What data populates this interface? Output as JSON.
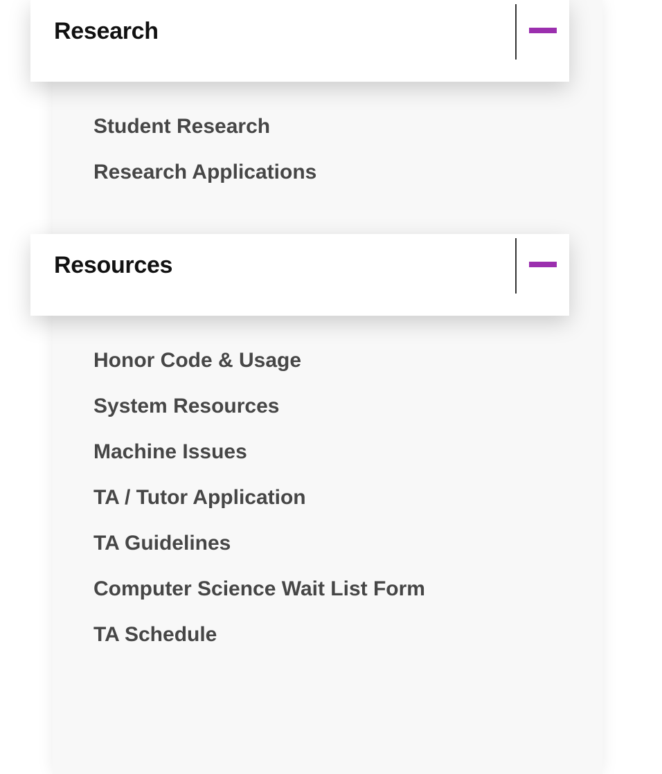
{
  "sections": [
    {
      "title": "Research",
      "items": [
        "Student Research",
        "Research Applications"
      ]
    },
    {
      "title": "Resources",
      "items": [
        "Honor Code & Usage",
        "System Resources",
        "Machine Issues",
        "TA / Tutor Application",
        "TA Guidelines",
        "Computer Science Wait List Form",
        "TA Schedule"
      ]
    }
  ],
  "colors": {
    "accent": "#9b2fae",
    "item_text": "#464646",
    "title_text": "#111111",
    "panel_bg": "#f8f8f8"
  },
  "icons": {
    "toggle": "minus-icon"
  }
}
